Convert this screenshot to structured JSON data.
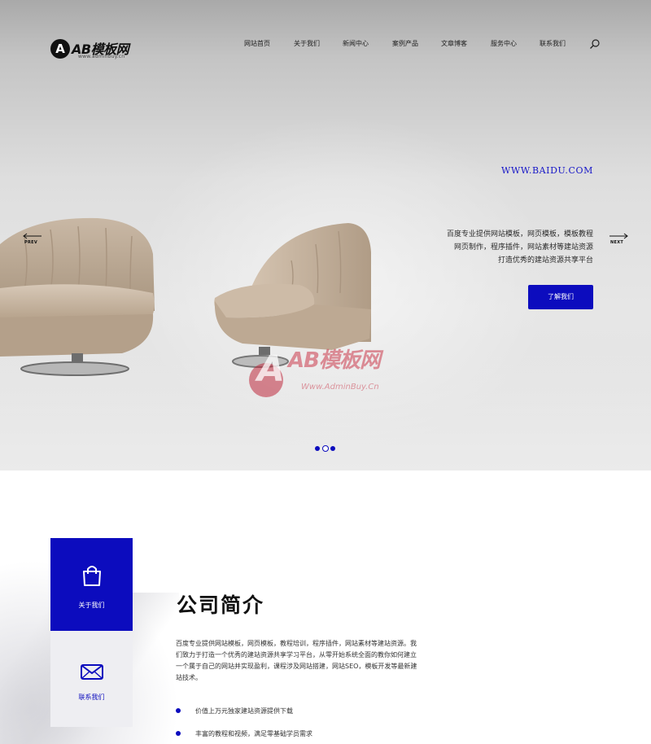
{
  "brand": {
    "logo_mark": "A",
    "logo_text": "AB模板网",
    "logo_sub": "www.adminbuy.cn"
  },
  "nav": {
    "items": [
      {
        "label": "网站首页"
      },
      {
        "label": "关于我们"
      },
      {
        "label": "新闻中心"
      },
      {
        "label": "案例产品"
      },
      {
        "label": "文章博客"
      },
      {
        "label": "服务中心"
      },
      {
        "label": "联系我们"
      }
    ]
  },
  "hero": {
    "url": "WWW.BAIDU.COM",
    "desc_lines": [
      "百度专业提供网站模板，网页模板，模板教程",
      "网页制作，程序插件，网站素材等建站资源",
      "打造优秀的建站资源共享平台"
    ],
    "button_label": "了解我们",
    "prev_label": "PREV",
    "next_label": "NEXT",
    "slides_count": 3,
    "active_slide": 2
  },
  "watermark": {
    "mark": "A",
    "text": "AB模板网",
    "sub": "Www.AdminBuy.Cn"
  },
  "about": {
    "tiles": [
      {
        "label": "关于我们",
        "icon": "shopping-bag-icon"
      },
      {
        "label": "联系我们",
        "icon": "envelope-icon"
      }
    ],
    "title": "公司简介",
    "body": "百度专业提供网站模板，网页模板，教程培训，程序插件，网站素材等建站资源。我们致力于打造一个优秀的建站资源共享学习平台，从零开始系统全面的教你如何建立一个属于自己的网站并实现盈利，课程涉及网站搭建，网站SEO，模板开发等最新建站技术。",
    "bullets": [
      "价值上万元独家建站资源提供下载",
      "丰富的教程和视频，满足零基础学员需求"
    ]
  },
  "colors": {
    "accent": "#0c0cbe",
    "hero_url": "#1717c8",
    "tile_light": "#eeeef2"
  }
}
